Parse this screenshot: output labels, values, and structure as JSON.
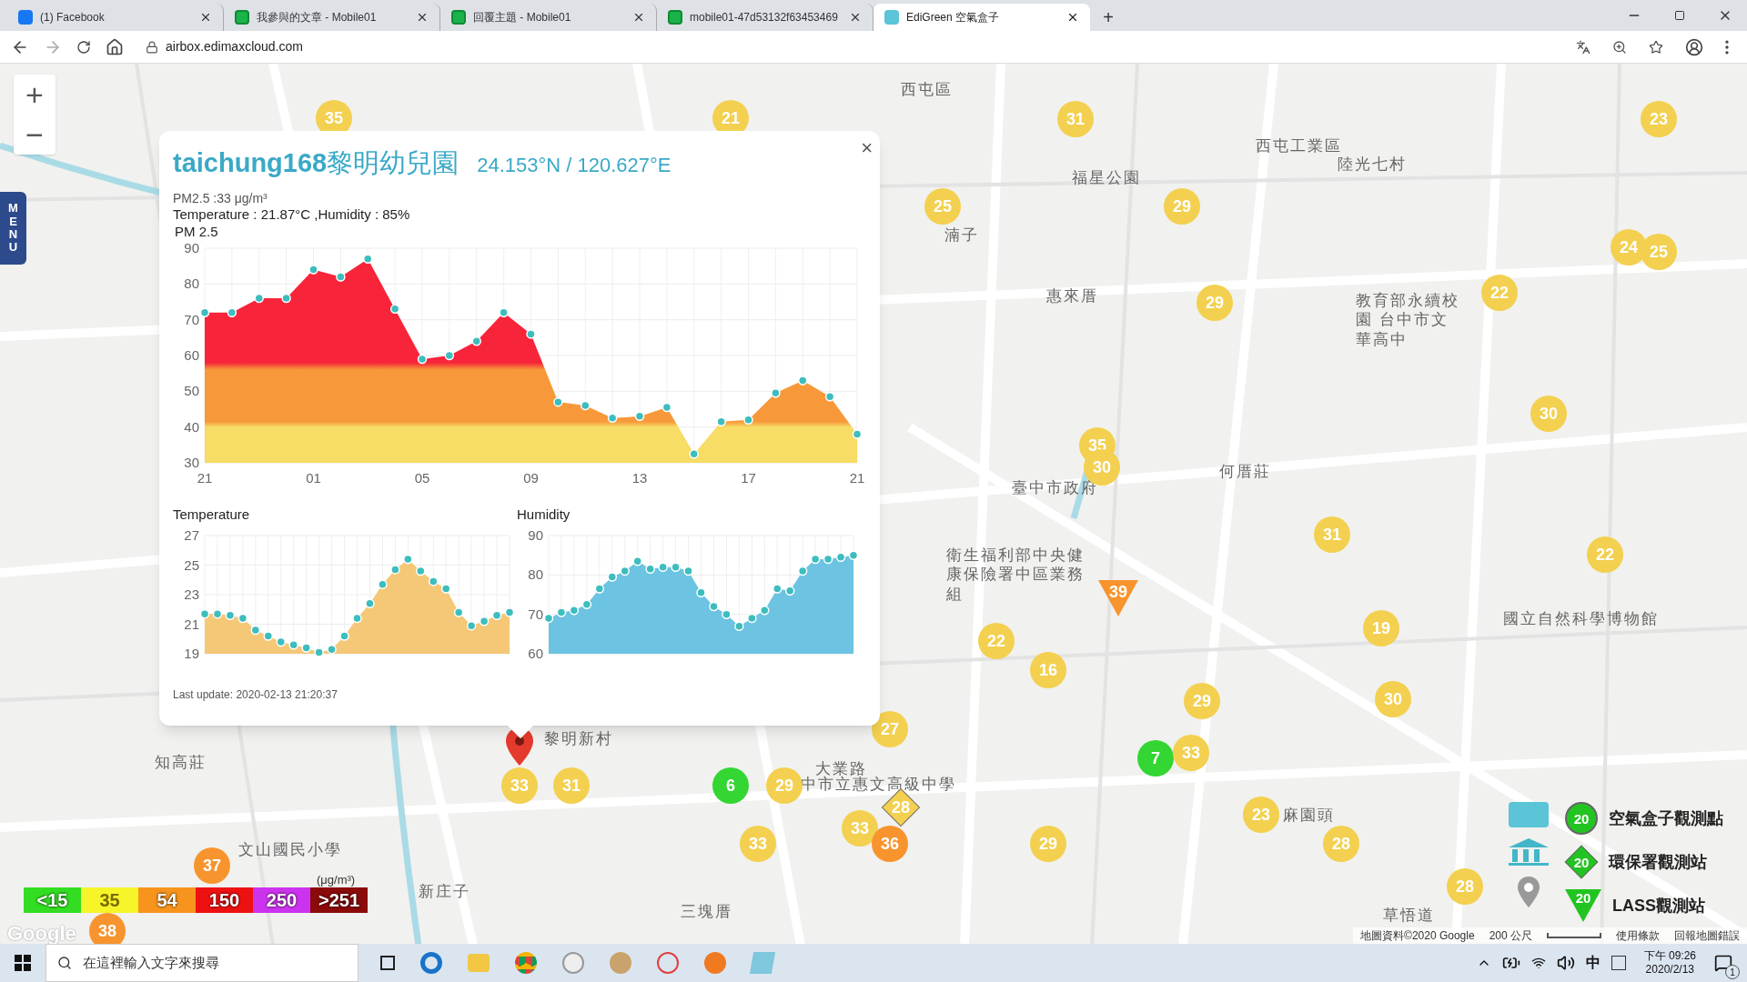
{
  "browser": {
    "tabs": [
      {
        "label": "(1) Facebook",
        "kind": "facebook",
        "selected": false
      },
      {
        "label": "我參與的文章 - Mobile01",
        "kind": "mobile01",
        "selected": false
      },
      {
        "label": "回覆主題 - Mobile01",
        "kind": "mobile01",
        "selected": false
      },
      {
        "label": "mobile01-47d53132f63453469",
        "kind": "mobile01",
        "selected": false
      },
      {
        "label": "EdiGreen 空氣盒子",
        "kind": "edigreen",
        "selected": true
      }
    ],
    "new_tab": "+",
    "address": "airbox.edimaxcloud.com"
  },
  "map": {
    "zoom_in": "+",
    "zoom_out": "−",
    "menu": "MENU",
    "labels": [
      "西屯區",
      "西屯工業區",
      "陸光七村",
      "福星公園",
      "湳子",
      "惠來厝",
      "教育部永續校園 台中市文華高中",
      "何厝莊",
      "臺中市政府",
      "衛生福利部中央健康保險署中區業務組",
      "國立自然科學博物館",
      "黎明新村",
      "知高莊",
      "大業路",
      "中市立惠文高級中學",
      "麻園頭",
      "文山國民小學",
      "新庄子",
      "三塊厝",
      "草悟道"
    ],
    "markers": [
      {
        "kind": "circle",
        "value": "35",
        "color": "#f3d04f"
      },
      {
        "kind": "circle",
        "value": "21",
        "color": "#f3d04f"
      },
      {
        "kind": "circle",
        "value": "31",
        "color": "#f3d04f"
      },
      {
        "kind": "circle",
        "value": "23",
        "color": "#f3d04f"
      },
      {
        "kind": "circle",
        "value": "25",
        "color": "#f3d04f"
      },
      {
        "kind": "circle",
        "value": "29",
        "color": "#f3d04f"
      },
      {
        "kind": "circle",
        "value": "24",
        "color": "#f3d04f"
      },
      {
        "kind": "circle",
        "value": "25",
        "color": "#f3d04f"
      },
      {
        "kind": "circle",
        "value": "29",
        "color": "#f3d04f"
      },
      {
        "kind": "circle",
        "value": "22",
        "color": "#f3d04f"
      },
      {
        "kind": "circle",
        "value": "30",
        "color": "#f3d04f"
      },
      {
        "kind": "circle",
        "value": "35",
        "color": "#f3d04f"
      },
      {
        "kind": "circle",
        "value": "30",
        "color": "#f3d04f"
      },
      {
        "kind": "circle",
        "value": "31",
        "color": "#f3d04f"
      },
      {
        "kind": "circle",
        "value": "22",
        "color": "#f3d04f"
      },
      {
        "kind": "triangle",
        "value": "39",
        "color": "#f7942e"
      },
      {
        "kind": "circle",
        "value": "22",
        "color": "#f3d04f"
      },
      {
        "kind": "circle",
        "value": "19",
        "color": "#f3d04f"
      },
      {
        "kind": "circle",
        "value": "16",
        "color": "#f3d04f"
      },
      {
        "kind": "circle",
        "value": "29",
        "color": "#f3d04f"
      },
      {
        "kind": "circle",
        "value": "30",
        "color": "#f3d04f"
      },
      {
        "kind": "circle",
        "value": "27",
        "color": "#f3d04f"
      },
      {
        "kind": "circle",
        "value": "7",
        "color": "#33d633"
      },
      {
        "kind": "circle",
        "value": "33",
        "color": "#f3d04f"
      },
      {
        "kind": "circle",
        "value": "33",
        "color": "#f3d04f"
      },
      {
        "kind": "circle",
        "value": "31",
        "color": "#f3d04f"
      },
      {
        "kind": "circle",
        "value": "6",
        "color": "#33d633"
      },
      {
        "kind": "circle",
        "value": "29",
        "color": "#f3d04f"
      },
      {
        "kind": "circle",
        "value": "33",
        "color": "#f3d04f"
      },
      {
        "kind": "circle",
        "value": "33",
        "color": "#f3d04f"
      },
      {
        "kind": "diamond",
        "value": "28",
        "color": "#f3d04f"
      },
      {
        "kind": "circle",
        "value": "36",
        "color": "#f7942e"
      },
      {
        "kind": "circle",
        "value": "29",
        "color": "#f3d04f"
      },
      {
        "kind": "circle",
        "value": "23",
        "color": "#f3d04f"
      },
      {
        "kind": "circle",
        "value": "28",
        "color": "#f3d04f"
      },
      {
        "kind": "circle",
        "value": "28",
        "color": "#f3d04f"
      },
      {
        "kind": "circle",
        "value": "37",
        "color": "#f7942e"
      },
      {
        "kind": "circle",
        "value": "38",
        "color": "#f7942e"
      }
    ],
    "popup": {
      "close": "×",
      "title": "**taichung168**黎明幼兒園",
      "coords": "24.153°N / 120.627°E",
      "pm_line": "PM2.5 :33 μg/m³",
      "weather_line": "Temperature : 21.87°C ,Humidity : 85%",
      "pm_chart": {
        "title": "PM 2.5",
        "chart_data": {
          "type": "area",
          "grid": true,
          "categories": [
            "21",
            null,
            null,
            null,
            "01",
            null,
            null,
            null,
            "05",
            null,
            null,
            null,
            "09",
            null,
            null,
            null,
            "13",
            null,
            null,
            null,
            "17",
            null,
            null,
            null,
            "21"
          ],
          "ylim": [
            30,
            90
          ],
          "yticks": [
            30,
            40,
            50,
            60,
            70,
            80,
            90
          ],
          "series": [
            {
              "color": "#3dbdbd",
              "values": [
                72,
                72,
                76,
                76,
                84,
                82,
                87,
                73,
                59,
                60,
                64,
                72,
                66,
                47,
                46,
                42.5,
                43,
                45.5,
                32.5,
                41.5,
                42,
                49.5,
                53,
                48.5,
                38
              ]
            }
          ]
        }
      },
      "temp_chart": {
        "title": "Temperature",
        "axis_labels": [
          "27",
          "25",
          "23",
          "21",
          "19"
        ]
      },
      "hum_chart": {
        "title": "Humidity",
        "axis_labels": [
          "90",
          "80",
          "70",
          "60"
        ]
      },
      "last_update": "Last update: 2020-02-13 21:20:37"
    },
    "scale_legend": {
      "unit": "(μg/m³)",
      "items": [
        {
          "label": "<15",
          "color": "#33dd22"
        },
        {
          "label": "35",
          "color": "#f5f52a"
        },
        {
          "label": "54",
          "color": "#f7941d"
        },
        {
          "label": "150",
          "color": "#ee1111"
        },
        {
          "label": "250",
          "color": "#cc33ee"
        },
        {
          "label": ">251",
          "color": "#8b0a0a"
        }
      ]
    },
    "station_legend": [
      {
        "kind": "circle",
        "badge": "20",
        "label": "空氣盒子觀測點"
      },
      {
        "kind": "diamond",
        "badge": "20",
        "label": "環保署觀測站"
      },
      {
        "kind": "triangle",
        "badge": "20",
        "label": "LASS觀測站"
      }
    ],
    "google_logo": "Google",
    "attribution": {
      "data": "地圖資料©2020 Google",
      "scale": "200 公尺",
      "terms": "使用條款",
      "report": "回報地圖錯誤"
    }
  },
  "taskbar": {
    "search_placeholder": "在這裡輸入文字來搜尋",
    "ime": "中",
    "time": "下午 09:26",
    "date": "2020/2/13",
    "notifications": "1"
  }
}
